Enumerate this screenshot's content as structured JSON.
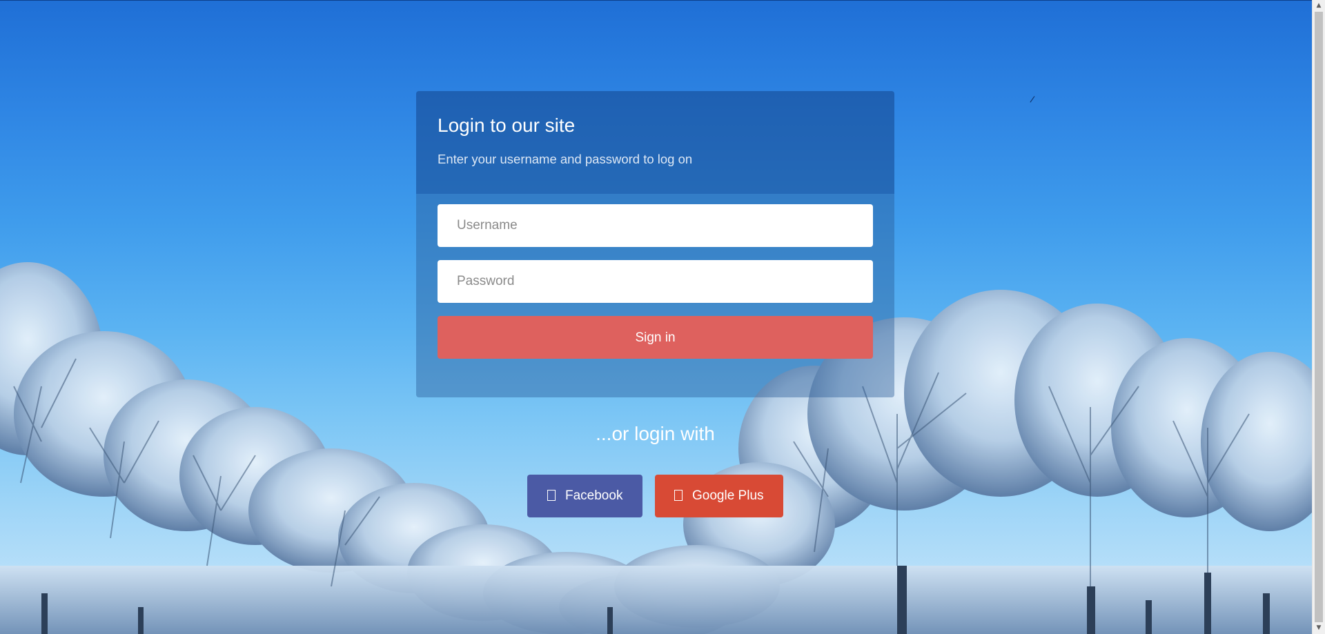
{
  "login": {
    "title": "Login to our site",
    "subtitle": "Enter your username and password to log on",
    "username_placeholder": "Username",
    "password_placeholder": "Password",
    "signin_label": "Sign in"
  },
  "alternate": {
    "heading": "...or login with",
    "facebook_label": "Facebook",
    "googleplus_label": "Google Plus"
  },
  "icons": {
    "facebook": "facebook-icon",
    "googleplus": "google-plus-icon"
  },
  "colors": {
    "signin": "#de615e",
    "facebook": "#4b5aa5",
    "googleplus": "#d84a35",
    "sky_top": "#1f6fd6",
    "sky_bottom": "#cde8fb"
  }
}
